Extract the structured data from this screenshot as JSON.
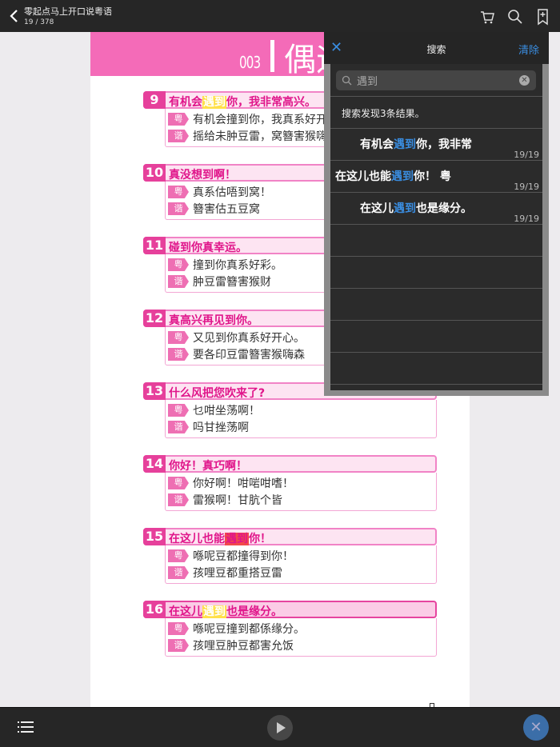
{
  "topbar": {
    "title": "零起点马上开口说粤语",
    "pages": "19 / 378"
  },
  "page": {
    "header_num": "003",
    "header_title": "偶遇"
  },
  "entries": [
    {
      "num": "9",
      "pre": "有机会",
      "hl": "遇到",
      "post": "你，我非常高兴。",
      "hl_color": "#ffe04a",
      "hl_text": "#ffffff",
      "yue": "有机会撞到你，我真系好开心。",
      "xie": "摇给未肿豆雷，窝簪害猴嗨森"
    },
    {
      "num": "10",
      "pre": "真没想到啊！",
      "hl": "",
      "post": "",
      "yue": "真系估唔到窝！",
      "xie": "簪害估五豆窝"
    },
    {
      "num": "11",
      "pre": "碰到你真幸运。",
      "hl": "",
      "post": "",
      "yue": "撞到你真系好彩。",
      "xie": "肿豆雷簪害猴财"
    },
    {
      "num": "12",
      "pre": "真高兴再见到你。",
      "hl": "",
      "post": "",
      "yue": "又见到你真系好开心。",
      "xie": "要各印豆雷簪害猴嗨森"
    },
    {
      "num": "13",
      "pre": "什么风把您吹来了?",
      "hl": "",
      "post": "",
      "yue": "乜咁坐荡啊！",
      "xie": "吗甘挫荡啊"
    },
    {
      "num": "14",
      "pre": "你好！真巧啊！",
      "hl": "",
      "post": "",
      "yue": "你好啊！咁啱咁嗜！",
      "xie": "雷猴啊！甘肮个皆"
    },
    {
      "num": "15",
      "pre": "在这儿也能",
      "hl": "遇到",
      "post": "你！",
      "hl_color": "#f24a4a",
      "hl_text": "#e0158a",
      "yue": "喺呢豆都撞得到你！",
      "xie": "孩哩豆都重搭豆雷"
    },
    {
      "num": "16",
      "pre": "在这儿",
      "hl": "遇到",
      "post": "也是缘分。",
      "hl_color": "#ffe04a",
      "hl_text": "#ffffff",
      "yue": "喺呢豆撞到都係缘分。",
      "xie": "孩哩豆肿豆都害允饭"
    }
  ],
  "tags": {
    "yue": "粤",
    "xie": "谐"
  },
  "search": {
    "title": "搜索",
    "clear": "清除",
    "query": "遇到",
    "summary": "搜索发现3条结果。",
    "results": [
      {
        "pre": "有机会",
        "key": "遇到",
        "post": "你，我非常",
        "page": "19/19",
        "indent": true
      },
      {
        "pre": "在这儿也能",
        "key": "遇到",
        "post": "你！ 粤",
        "page": "19/19",
        "indent": false
      },
      {
        "pre": "在这儿",
        "key": "遇到",
        "post": "也是缘分。",
        "page": "19/19",
        "indent": true
      }
    ]
  },
  "colors": {
    "accent": "#3a8de0",
    "pink": "#f46bb8",
    "magenta": "#e0158a"
  }
}
